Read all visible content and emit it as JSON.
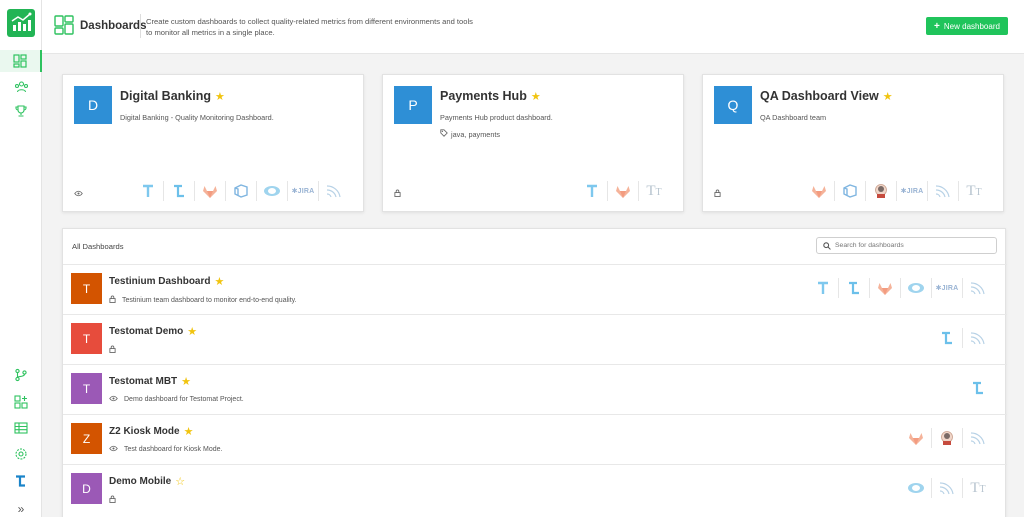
{
  "header": {
    "title": "Dashboards",
    "description": "Create custom dashboards to collect quality-related metrics from different environments and tools to monitor all metrics in a single place.",
    "new_button": "New dashboard"
  },
  "colors": {
    "accent": "#20c45b",
    "star": "#f1c40f",
    "blue": "#2e8fd6",
    "orange": "#d35400",
    "red": "#e74c3c",
    "purple": "#9b59b6"
  },
  "favorites": [
    {
      "initial": "D",
      "title": "Digital Banking",
      "description": "Digital Banking - Quality Monitoring Dashboard.",
      "tags": "",
      "visibility": "public",
      "tools": [
        "testinium-icon",
        "testomat-icon",
        "gitlab-icon",
        "azure-icon",
        "tosca-icon",
        "jira-icon",
        "signal-icon"
      ]
    },
    {
      "initial": "P",
      "title": "Payments Hub",
      "description": "Payments Hub product dashboard.",
      "tags": "java, payments",
      "visibility": "private",
      "tools": [
        "testinium-icon",
        "gitlab-icon",
        "text-icon"
      ]
    },
    {
      "initial": "Q",
      "title": "QA Dashboard View",
      "description": "QA Dashboard team",
      "tags": "",
      "visibility": "private",
      "tools": [
        "gitlab-icon",
        "azure-icon",
        "jenkins-icon",
        "jira-icon",
        "signal-icon",
        "text-icon"
      ]
    }
  ],
  "list": {
    "title": "All Dashboards",
    "search_placeholder": "Search for dashboards",
    "rows": [
      {
        "initial": "T",
        "title": "Testinium Dashboard",
        "description": "Testinium team dashboard to monitor end-to-end quality.",
        "favorite": true,
        "visibility": "private",
        "tools": [
          "testinium-icon",
          "testomat-icon",
          "gitlab-icon",
          "tosca-icon",
          "jira-icon",
          "signal-icon"
        ]
      },
      {
        "initial": "T",
        "title": "Testomat Demo",
        "description": "",
        "favorite": true,
        "visibility": "private",
        "tools": [
          "testomat-icon",
          "signal-icon"
        ]
      },
      {
        "initial": "T",
        "title": "Testomat MBT",
        "description": "Demo dashboard for Testomat Project.",
        "favorite": true,
        "visibility": "public",
        "tools": [
          "testomat-icon"
        ]
      },
      {
        "initial": "Z",
        "title": "Z2 Kiosk Mode",
        "description": "Test dashboard for Kiosk Mode.",
        "favorite": true,
        "visibility": "public",
        "tools": [
          "gitlab-icon",
          "jenkins-icon",
          "signal-icon"
        ]
      },
      {
        "initial": "D",
        "title": "Demo Mobile",
        "description": "",
        "favorite": false,
        "visibility": "private",
        "tools": [
          "tosca-icon",
          "signal-icon",
          "text-icon"
        ]
      }
    ]
  },
  "sidebar": {
    "expand_label": "»"
  }
}
